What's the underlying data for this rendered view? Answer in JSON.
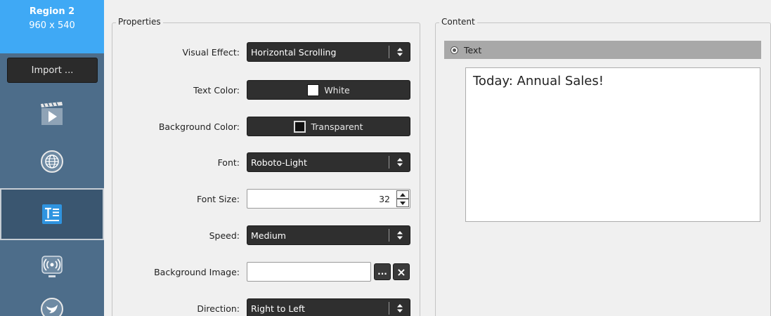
{
  "sidebar": {
    "region_name": "Region 2",
    "region_size": "960 x 540",
    "import_label": "Import ...",
    "icons": [
      "video-clapper-icon",
      "globe-icon",
      "text-icon",
      "stream-icon",
      "twitter-icon"
    ]
  },
  "properties": {
    "legend": "Properties",
    "visual_effect": {
      "label": "Visual Effect:",
      "value": "Horizontal Scrolling"
    },
    "text_color": {
      "label": "Text Color:",
      "value": "White",
      "swatch": "#ffffff"
    },
    "background_color": {
      "label": "Background Color:",
      "value": "Transparent",
      "swatch": "#111111"
    },
    "font": {
      "label": "Font:",
      "value": "Roboto-Light"
    },
    "font_size": {
      "label": "Font Size:",
      "value": "32"
    },
    "speed": {
      "label": "Speed:",
      "value": "Medium"
    },
    "background_image": {
      "label": "Background Image:",
      "value": "",
      "browse_label": "...",
      "clear_label": "×"
    },
    "direction": {
      "label": "Direction:",
      "value": "Right to Left"
    }
  },
  "content": {
    "legend": "Content",
    "type_label": "Text",
    "text_value": "Today: Annual Sales!"
  },
  "colors": {
    "accent": "#3fa9f5",
    "sidebar": "#4d6d8a",
    "button_dark": "#2f2f2f"
  }
}
